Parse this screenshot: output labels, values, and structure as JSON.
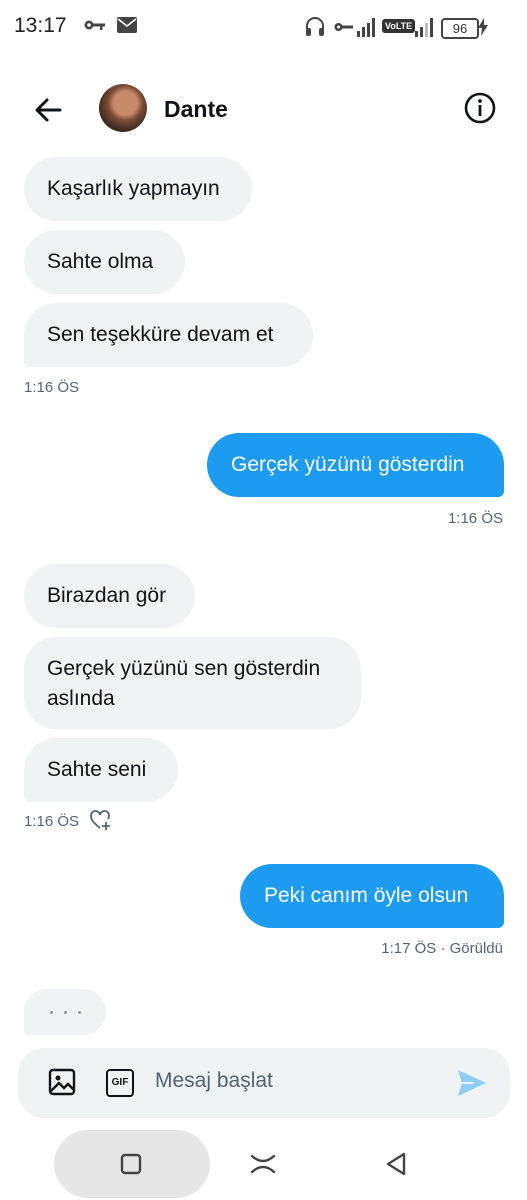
{
  "status_bar": {
    "time": "13:17",
    "network": "VoLTE",
    "battery": "96"
  },
  "header": {
    "contact_name": "Dante"
  },
  "messages": [
    {
      "dir": "in",
      "text": "Kaşarlık yapmayın"
    },
    {
      "dir": "in",
      "text": "Sahte olma"
    },
    {
      "dir": "in",
      "text": "Sen teşekküre devam et"
    },
    {
      "timestamp": "1:16 ÖS"
    },
    {
      "dir": "out",
      "text": "Gerçek yüzünü gösterdin"
    },
    {
      "timestamp": "1:16 ÖS"
    },
    {
      "dir": "in",
      "text": "Birazdan gör"
    },
    {
      "dir": "in",
      "text": "Gerçek yüzünü sen gösterdin aslında"
    },
    {
      "dir": "in",
      "text": "Sahte seni"
    },
    {
      "timestamp": "1:16 ÖS"
    },
    {
      "dir": "out",
      "text": "Peki canım öyle olsun"
    },
    {
      "timestamp": "1:17 ÖS · Görüldü"
    }
  ],
  "composer": {
    "placeholder": "Mesaj başlat",
    "gif_label": "GIF"
  },
  "colors": {
    "accent": "#1d9bf0",
    "incoming_bubble": "#eff3f4",
    "muted_text": "#536471"
  }
}
